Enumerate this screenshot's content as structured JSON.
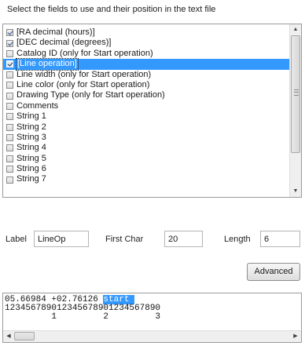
{
  "heading": "Select the fields to use and their position in the text file",
  "fields": [
    {
      "label": "[RA decimal (hours)]",
      "checked": true,
      "selected": false
    },
    {
      "label": "[DEC decimal (degrees)]",
      "checked": true,
      "selected": false
    },
    {
      "label": "Catalog ID (only for Start operation)",
      "checked": false,
      "selected": false
    },
    {
      "label": "[Line operation]",
      "checked": true,
      "selected": true
    },
    {
      "label": "Line width (only for Start operation)",
      "checked": false,
      "selected": false
    },
    {
      "label": "Line color (only for Start operation)",
      "checked": false,
      "selected": false
    },
    {
      "label": "Drawing Type (only for Start operation)",
      "checked": false,
      "selected": false
    },
    {
      "label": "Comments",
      "checked": false,
      "selected": false
    },
    {
      "label": "String 1",
      "checked": false,
      "selected": false
    },
    {
      "label": "String 2",
      "checked": false,
      "selected": false
    },
    {
      "label": "String 3",
      "checked": false,
      "selected": false
    },
    {
      "label": "String 4",
      "checked": false,
      "selected": false
    },
    {
      "label": "String 5",
      "checked": false,
      "selected": false
    },
    {
      "label": "String 6",
      "checked": false,
      "selected": false
    },
    {
      "label": "String 7",
      "checked": false,
      "selected": false
    }
  ],
  "editor": {
    "label_caption": "Label",
    "label_value": "LineOp",
    "first_char_caption": "First Char",
    "first_char_value": "20",
    "length_caption": "Length",
    "length_value": "6",
    "advanced_button": "Advanced"
  },
  "preview": {
    "line1_before": "05.66984 +02.76126 ",
    "line1_highlight": "start ",
    "line2": "123456789012345678901234567890",
    "line3": "         1         2         3"
  },
  "icons": {
    "scroll_up": "arrow-up-icon",
    "scroll_down": "arrow-down-icon",
    "scroll_left": "arrow-left-icon",
    "scroll_right": "arrow-right-icon"
  },
  "colors": {
    "selection": "#3399ff"
  }
}
